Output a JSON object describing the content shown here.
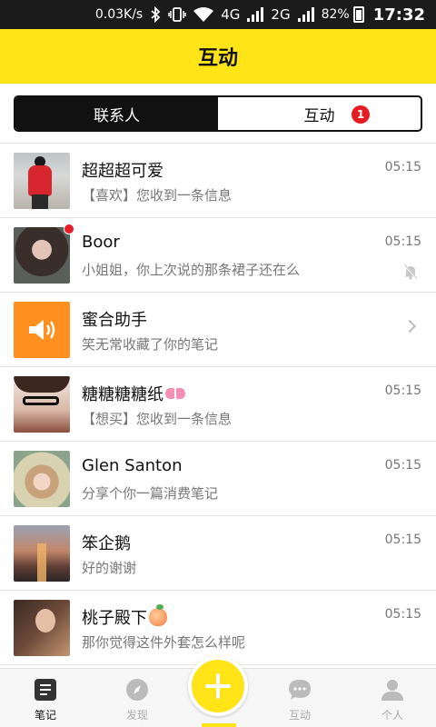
{
  "status_bar": {
    "speed": "0.03K/s",
    "net1": "4G",
    "net2": "2G",
    "battery": "82%",
    "time": "17:32"
  },
  "header": {
    "title": "互动"
  },
  "tabs": [
    {
      "label": "联系人",
      "active": true
    },
    {
      "label": "互动",
      "active": false,
      "badge": "1"
    }
  ],
  "conversations": [
    {
      "name": "超超超可爱",
      "message": "【喜欢】您收到一条信息",
      "time": "05:15"
    },
    {
      "name": "Boor",
      "message": "小姐姐，你上次说的那条裙子还在么",
      "time": "05:15",
      "unread": true,
      "muted": true
    },
    {
      "name": "蜜合助手",
      "message": "笑无常收藏了你的笔记",
      "time": ""
    },
    {
      "name": "糖糖糖糖纸",
      "message": "【想买】您收到一条信息",
      "time": "05:15",
      "emoji": "ribbon"
    },
    {
      "name": "Glen Santon",
      "message": "分享个你一篇消费笔记",
      "time": "05:15"
    },
    {
      "name": "笨企鹅",
      "message": "好的谢谢",
      "time": "05:15"
    },
    {
      "name": "桃子殿下",
      "message": "那你觉得这件外套怎么样呢",
      "time": "05:15",
      "emoji": "peach"
    }
  ],
  "bottom_nav": [
    {
      "label": "笔记",
      "icon": "notes-icon",
      "active": true
    },
    {
      "label": "发现",
      "icon": "compass-icon",
      "active": false
    },
    {
      "label": "",
      "icon": "plus-icon",
      "active": false
    },
    {
      "label": "互动",
      "icon": "chat-bubble-icon",
      "active": false
    },
    {
      "label": "个人",
      "icon": "person-icon",
      "active": false
    }
  ],
  "colors": {
    "accent": "#ffe418",
    "badge": "#e51c23",
    "status_bar": "#1b1b1b",
    "system_avatar": "#ff8f1f"
  }
}
